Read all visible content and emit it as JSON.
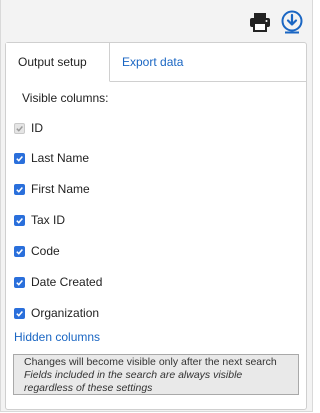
{
  "toolbar": {
    "print_icon": "printer-icon",
    "download_icon": "download-circle-icon"
  },
  "tabs": [
    {
      "label": "Output setup",
      "active": true
    },
    {
      "label": "Export data",
      "active": false
    }
  ],
  "section_title": "Visible columns:",
  "columns": [
    {
      "label": "ID",
      "checked": true,
      "disabled": true
    },
    {
      "label": "Last Name",
      "checked": true,
      "disabled": false
    },
    {
      "label": "First Name",
      "checked": true,
      "disabled": false
    },
    {
      "label": "Tax ID",
      "checked": true,
      "disabled": false
    },
    {
      "label": "Code",
      "checked": true,
      "disabled": false
    },
    {
      "label": "Date Created",
      "checked": true,
      "disabled": false
    },
    {
      "label": "Organization",
      "checked": true,
      "disabled": false
    }
  ],
  "hidden_columns_link": "Hidden columns",
  "note": {
    "line1": "Changes will become visible only after the next search",
    "line2": "Fields included in the search are always visible regardless of these settings"
  },
  "colors": {
    "accent": "#1a66c3",
    "checkbox": "#2a6fdb"
  }
}
